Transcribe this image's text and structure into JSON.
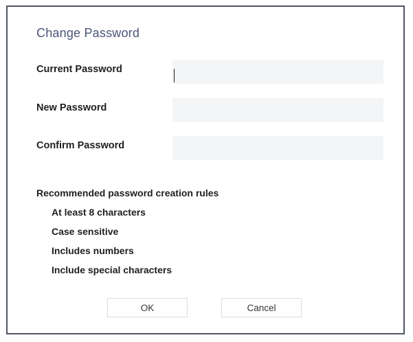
{
  "dialog": {
    "title": "Change Password",
    "fields": [
      {
        "label": "Current Password",
        "value": "",
        "placeholder": ""
      },
      {
        "label": "New Password",
        "value": "",
        "placeholder": ""
      },
      {
        "label": "Confirm Password",
        "value": "",
        "placeholder": ""
      }
    ],
    "rules": {
      "heading": "Recommended password creation rules",
      "items": [
        "At least 8 characters",
        "Case sensitive",
        "Includes numbers",
        "Include special characters"
      ]
    },
    "buttons": {
      "ok_label": "OK",
      "cancel_label": "Cancel"
    }
  }
}
